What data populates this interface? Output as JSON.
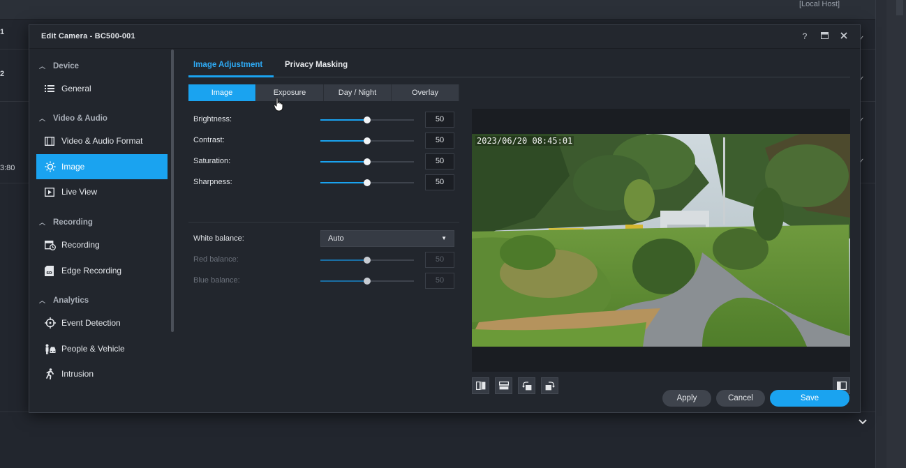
{
  "background": {
    "host_label": "[Local Host]",
    "left_fragments": [
      "1",
      "2",
      "3:80"
    ]
  },
  "dialog": {
    "title": "Edit Camera - BC500-001",
    "help": "?",
    "maximize": "▣",
    "close": "✕"
  },
  "sidebar": {
    "sections": [
      {
        "label": "Device",
        "items": [
          {
            "label": "General",
            "icon": "list-icon"
          }
        ]
      },
      {
        "label": "Video & Audio",
        "items": [
          {
            "label": "Video & Audio Format",
            "icon": "film-icon"
          },
          {
            "label": "Image",
            "icon": "brightness-icon",
            "active": true
          },
          {
            "label": "Live View",
            "icon": "play-box-icon"
          }
        ]
      },
      {
        "label": "Recording",
        "items": [
          {
            "label": "Recording",
            "icon": "calendar-clock-icon"
          },
          {
            "label": "Edge Recording",
            "icon": "sd-card-icon"
          }
        ]
      },
      {
        "label": "Analytics",
        "items": [
          {
            "label": "Event Detection",
            "icon": "crosshair-icon"
          },
          {
            "label": "People & Vehicle",
            "icon": "people-vehicle-icon"
          },
          {
            "label": "Intrusion",
            "icon": "running-person-icon"
          }
        ]
      }
    ]
  },
  "tabs": {
    "primary": [
      "Image Adjustment",
      "Privacy Masking"
    ],
    "active_primary": "Image Adjustment",
    "sub": [
      "Image",
      "Exposure",
      "Day / Night",
      "Overlay"
    ],
    "active_sub": "Image"
  },
  "adjustments": [
    {
      "label": "Brightness:",
      "value": "50",
      "level": 0.5
    },
    {
      "label": "Contrast:",
      "value": "50",
      "level": 0.5
    },
    {
      "label": "Saturation:",
      "value": "50",
      "level": 0.5
    },
    {
      "label": "Sharpness:",
      "value": "50",
      "level": 0.5
    }
  ],
  "white_balance": {
    "label": "White balance:",
    "value": "Auto"
  },
  "balances": [
    {
      "label": "Red balance:",
      "value": "50",
      "level": 0.5,
      "disabled": true
    },
    {
      "label": "Blue balance:",
      "value": "50",
      "level": 0.5,
      "disabled": true
    }
  ],
  "preview": {
    "timestamp": "2023/06/20 08:45:01",
    "tools": [
      "flip-horizontal-icon",
      "flip-vertical-icon",
      "rotate-left-icon",
      "rotate-right-icon"
    ],
    "split_view_icon": "split-view-icon"
  },
  "footer": {
    "apply": "Apply",
    "cancel": "Cancel",
    "save": "Save"
  },
  "colors": {
    "accent": "#1aa3f0",
    "dialog_bg": "#22262d",
    "button_gray": "#3f444d"
  }
}
